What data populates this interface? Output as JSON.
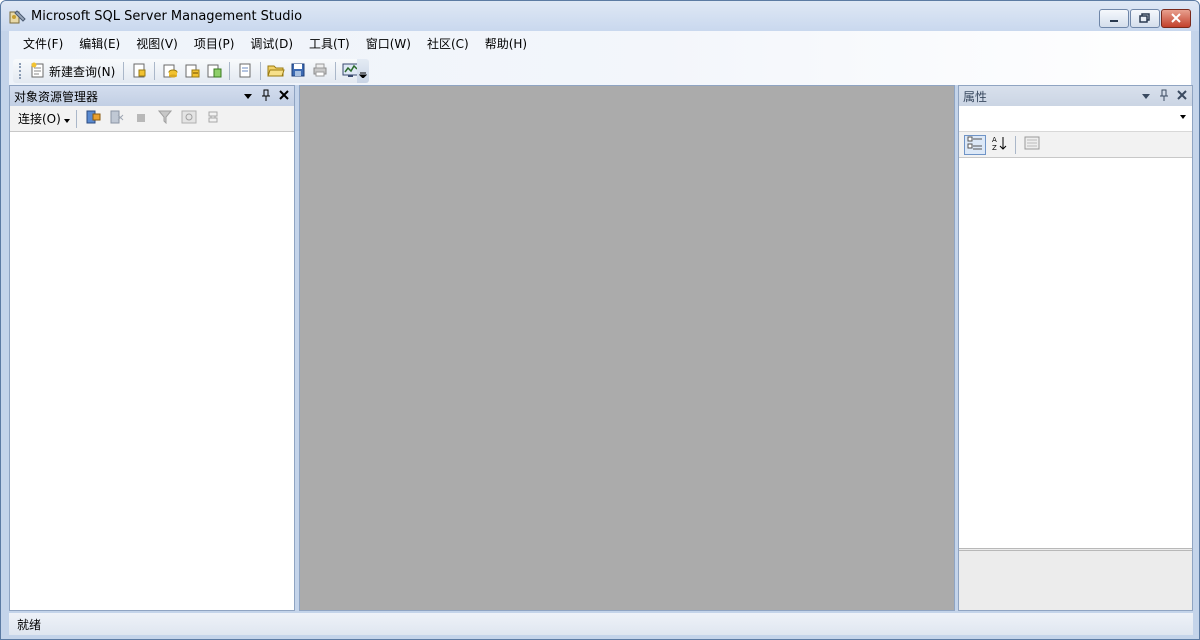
{
  "window": {
    "title": "Microsoft SQL Server Management Studio"
  },
  "menu": {
    "items": [
      "文件(F)",
      "编辑(E)",
      "视图(V)",
      "项目(P)",
      "调试(D)",
      "工具(T)",
      "窗口(W)",
      "社区(C)",
      "帮助(H)"
    ]
  },
  "toolbar": {
    "new_query_label": "新建查询(N)"
  },
  "object_explorer": {
    "title": "对象资源管理器",
    "connect_label": "连接(O)"
  },
  "properties": {
    "title": "属性"
  },
  "status": {
    "text": "就绪"
  },
  "colors": {
    "accent": "#c4d4ea",
    "document_area": "#ababab",
    "close_button": "#c2412c"
  }
}
